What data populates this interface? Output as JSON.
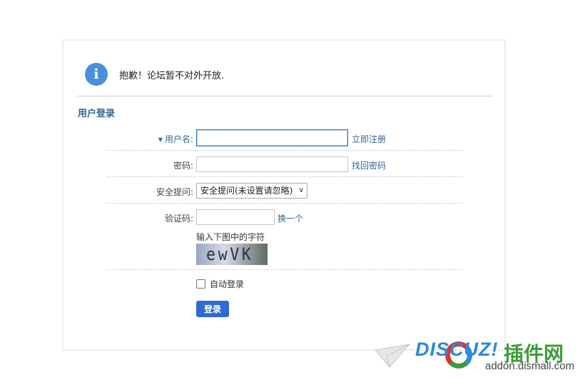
{
  "notice": {
    "icon": "info-icon",
    "glyph": "i",
    "message": "抱歉！论坛暂不对外开放."
  },
  "login": {
    "section_title": "用户登录",
    "username": {
      "label": "用户名:",
      "value": "",
      "link": "立即注册"
    },
    "password": {
      "label": "密码:",
      "value": "",
      "link": "找回密码"
    },
    "security": {
      "label": "安全提问:",
      "selected": "安全提问(未设置请忽略)"
    },
    "captcha": {
      "label": "验证码:",
      "value": "",
      "refresh": "换一个",
      "hint": "输入下图中的字符",
      "image_text": "ewVK"
    },
    "auto_login": {
      "label": "自动登录",
      "checked": false
    },
    "submit": "登录"
  },
  "watermark": {
    "brand": "DISCUZ!",
    "name": "插件网",
    "site": "addon.dismall.com"
  },
  "colors": {
    "accent": "#2f6bd3",
    "link": "#336699",
    "info": "#4a90d9"
  }
}
